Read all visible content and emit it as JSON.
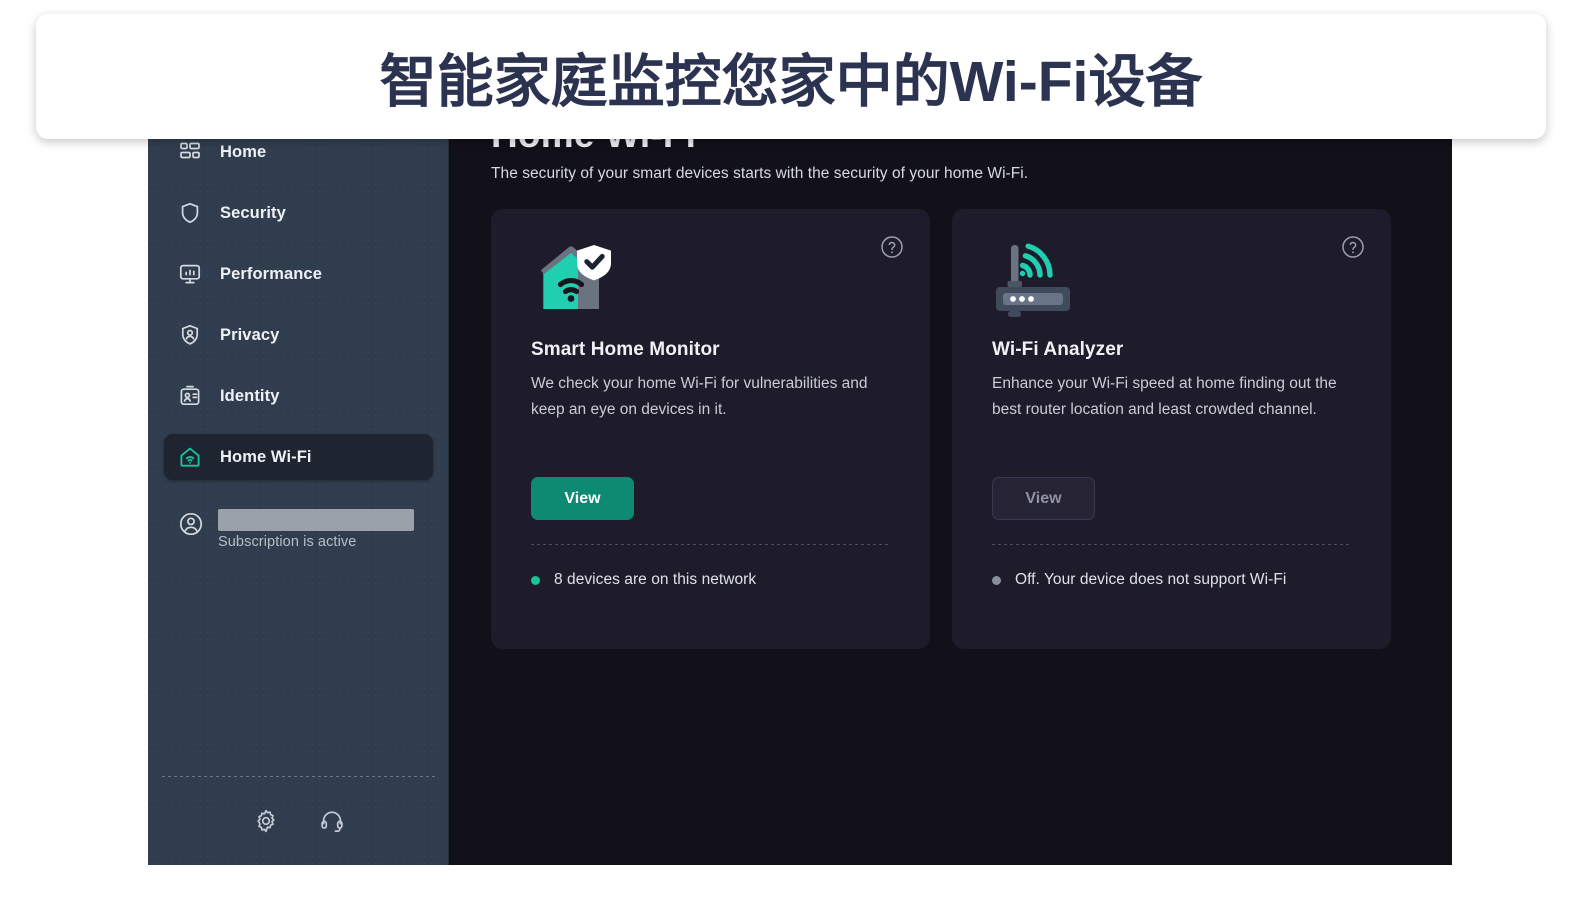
{
  "banner": {
    "text": "智能家庭监控您家中的Wi-Fi设备"
  },
  "sidebar": {
    "items": [
      {
        "label": "Home",
        "icon": "home-grid-icon",
        "active": false
      },
      {
        "label": "Security",
        "icon": "shield-icon",
        "active": false
      },
      {
        "label": "Performance",
        "icon": "monitor-icon",
        "active": false
      },
      {
        "label": "Privacy",
        "icon": "privacy-shield-icon",
        "active": false
      },
      {
        "label": "Identity",
        "icon": "id-card-icon",
        "active": false
      },
      {
        "label": "Home Wi-Fi",
        "icon": "home-wifi-icon",
        "active": true
      }
    ],
    "account": {
      "icon": "user-circle-icon",
      "name_redacted": "",
      "status": "Subscription is active"
    },
    "footer": [
      {
        "name": "settings-button",
        "icon": "gear-icon"
      },
      {
        "name": "support-button",
        "icon": "headset-icon"
      }
    ]
  },
  "main": {
    "title": "Home Wi-Fi",
    "subtitle": "The security of your smart devices starts with the security of your home Wi-Fi.",
    "cards": [
      {
        "id": "smart-home-monitor",
        "illustration": "house-shield-wifi-icon",
        "title": "Smart Home Monitor",
        "description": "We check your home Wi-Fi for vulnerabilities and keep an eye on devices in it.",
        "button_label": "View",
        "button_state": "enabled",
        "status_text": "8 devices are on this network",
        "status_color": "#16c596",
        "help_icon": "help-circle-icon"
      },
      {
        "id": "wifi-analyzer",
        "illustration": "router-wifi-icon",
        "title": "Wi-Fi Analyzer",
        "description": "Enhance your Wi-Fi speed at home finding out the best router location and least crowded channel.",
        "button_label": "View",
        "button_state": "disabled",
        "status_text": "Off. Your device does not support Wi-Fi",
        "status_color": "#8b8f9d",
        "help_icon": "help-circle-icon"
      }
    ]
  },
  "colors": {
    "accent_teal": "#16c596",
    "button_green": "#0f8a72",
    "sidebar_bg": "#303d4e",
    "main_bg": "#121119",
    "card_bg": "#1e1c2a",
    "banner_text": "#2b3350"
  }
}
